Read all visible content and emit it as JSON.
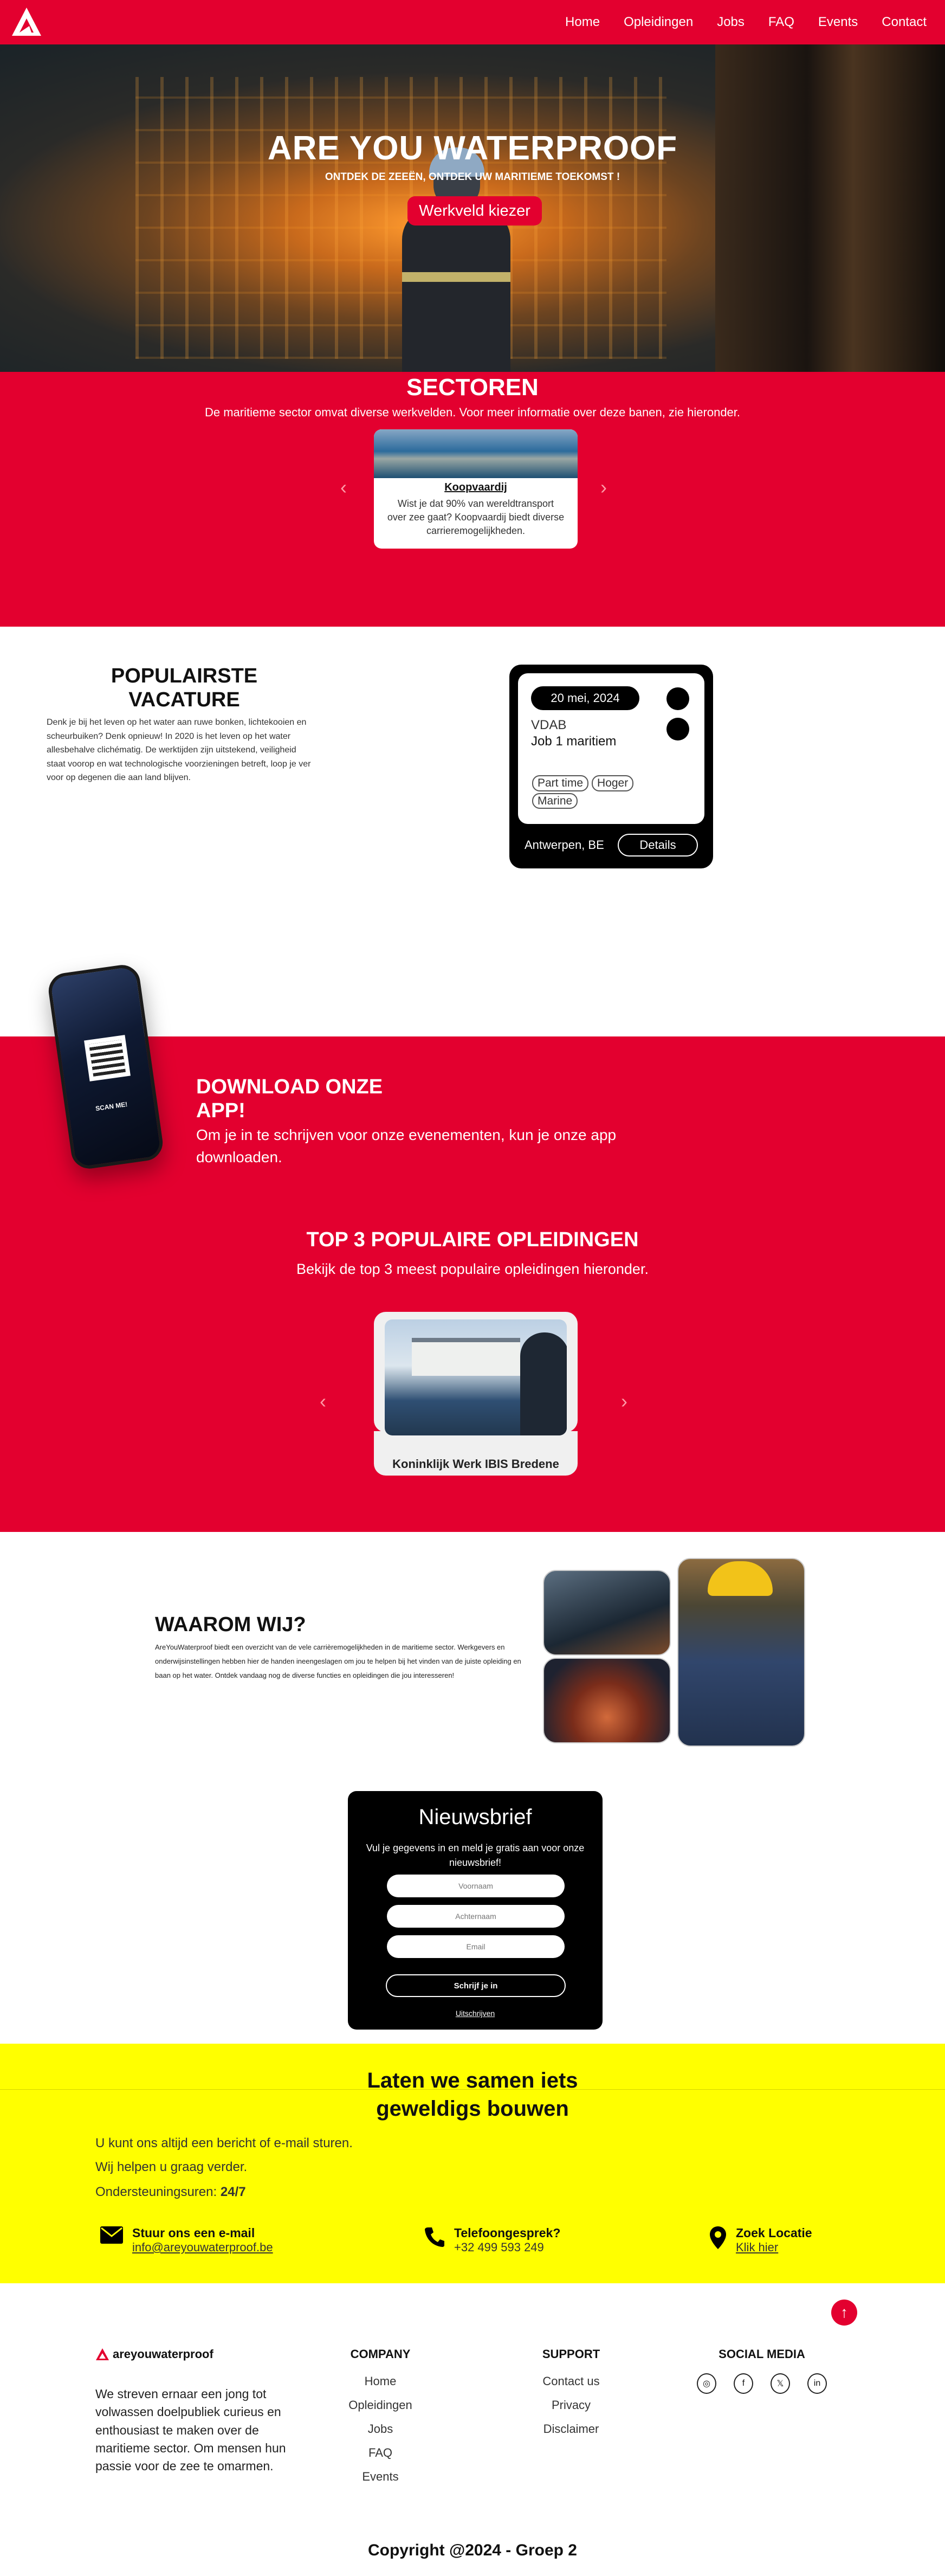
{
  "nav": {
    "logo_icon": "mountain-logo-icon",
    "links": [
      "Home",
      "Opleidingen",
      "Jobs",
      "FAQ",
      "Events",
      "Contact"
    ]
  },
  "hero": {
    "title": "ARE YOU WATERPROOF",
    "subtitle": "ONTDEK DE ZEEËN, ONTDEK UW MARITIEME TOEKOMST !",
    "button": "Werkveld kiezer"
  },
  "sectoren": {
    "title": "SECTOREN",
    "subtitle": "De maritieme sector omvat diverse werkvelden. Voor meer informatie over deze banen, zie hieronder.",
    "card": {
      "title": "Koopvaardij",
      "text": "Wist je dat 90% van wereldtransport over zee gaat? Koopvaardij biedt diverse carrieremogelijkheden."
    },
    "prev": "‹",
    "next": "›"
  },
  "vacature": {
    "title": "POPULAIRSTE VACATURE",
    "text": "Denk je bij het leven op het water aan ruwe bonken, lichtekooien en scheurbuiken? Denk opnieuw! In 2020 is het leven op het water allesbehalve clichématig. De werktijden zijn uitstekend, veiligheid staat voorop en wat technologische voorzieningen betreft, loop je ver voor op degenen die aan land blijven.",
    "job": {
      "date": "20 mei, 2024",
      "company": "VDAB",
      "name": "Job 1 maritiem",
      "tags": [
        "Part time",
        "Hoger",
        "Marine"
      ],
      "location": "Antwerpen, BE",
      "button": "Details"
    }
  },
  "app": {
    "title": "DOWNLOAD ONZE APP!",
    "text": "Om je in te schrijven voor onze evenementen, kun je onze app downloaden.",
    "scan": "SCAN ME!"
  },
  "top3": {
    "title": "TOP 3 POPULAIRE OPLEIDINGEN",
    "subtitle": "Bekijk de top 3 meest populaire opleidingen hieronder.",
    "card_name": "Koninklijk Werk IBIS Bredene",
    "prev": "‹",
    "next": "›"
  },
  "waarom": {
    "title": "WAAROM WIJ?",
    "text": "AreYouWaterproof biedt een overzicht van de vele carrièremogelijkheden in de maritieme sector. Werkgevers en onderwijsinstellingen hebben hier de handen ineengeslagen om jou te helpen bij het vinden van de juiste opleiding en baan op het water. Ontdek vandaag nog de diverse functies en opleidingen die jou interesseren!"
  },
  "newsletter": {
    "title": "Nieuwsbrief",
    "text": "Vul je gegevens in en meld je gratis aan voor onze nieuwsbrief!",
    "placeholders": {
      "first": "Voornaam",
      "last": "Achternaam",
      "email": "Email"
    },
    "button": "Schrijf je in",
    "unsubscribe": "Uitschrijven"
  },
  "contact": {
    "title_line1": "Laten we samen iets",
    "title_line2": "geweldigs bouwen",
    "line1": "U kunt ons altijd een bericht of e-mail sturen.",
    "line2": "Wij helpen u graag verder.",
    "support_label": "Ondersteuningsuren:",
    "support_value": "24/7",
    "email": {
      "label": "Stuur ons een e-mail",
      "value": "info@areyouwaterproof.be",
      "icon": "mail-icon"
    },
    "phone": {
      "label": "Telefoongesprek?",
      "value": "+32 499 593 249",
      "icon": "phone-icon"
    },
    "location": {
      "label": "Zoek Locatie",
      "value": "Klik hier",
      "icon": "location-pin-icon"
    }
  },
  "footer": {
    "brand": "areyouwaterproof",
    "desc": "We streven ernaar een jong tot volwassen doelpubliek curieus en enthousiast te maken over de maritieme sector. Om mensen hun passie voor de zee te omarmen.",
    "company_title": "COMPANY",
    "company_links": [
      "Home",
      "Opleidingen",
      "Jobs",
      "FAQ",
      "Events"
    ],
    "support_title": "SUPPORT",
    "support_links": [
      "Contact us",
      "Privacy",
      "Disclaimer"
    ],
    "social_title": "SOCIAL MEDIA",
    "social_icons": [
      "instagram-icon",
      "facebook-icon",
      "x-icon",
      "linkedin-icon"
    ],
    "social_glyphs": [
      "◎",
      "f",
      "𝕏",
      "in"
    ],
    "scroll_top": "↑",
    "copyright": "Copyright @2024 - Groep 2"
  },
  "colors": {
    "brand_red": "#e3002f",
    "contact_yellow": "#ffff00",
    "black": "#000000"
  }
}
